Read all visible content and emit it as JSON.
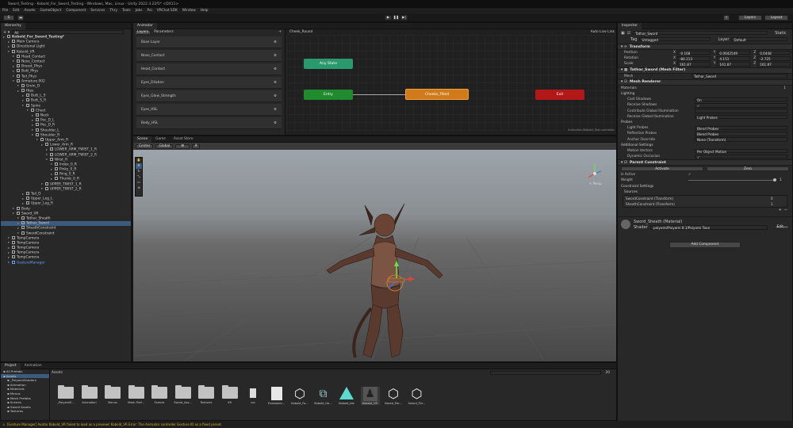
{
  "window": {
    "title": "Sword_Testing - Kobold_For_Sword_Testing - Windows, Mac, Linux - Unity 2022.3.22f1* <DX11>"
  },
  "menu": [
    "File",
    "Edit",
    "Assets",
    "GameObject",
    "Component",
    "Services",
    "Thry",
    "Tools",
    "Jobs",
    "Poi",
    "VRChat SDK",
    "Window",
    "Help"
  ],
  "toolbar": {
    "account": "S",
    "layers": "Layers",
    "layout": "Layout"
  },
  "hierarchy": {
    "tab": "Hierarchy",
    "search_placeholder": "All",
    "items": [
      {
        "label": "Kobold_For_Sword_Testing*",
        "indent": 0,
        "scene": true
      },
      {
        "label": "Main Camera",
        "indent": 1
      },
      {
        "label": "Directional Light",
        "indent": 1
      },
      {
        "label": "Kobold_VR",
        "indent": 1
      },
      {
        "label": "Head_Contact",
        "indent": 2
      },
      {
        "label": "Nose_Contact",
        "indent": 2
      },
      {
        "label": "Breast_Phys",
        "indent": 2
      },
      {
        "label": "Butt_Phys",
        "indent": 2
      },
      {
        "label": "Tail_Phys",
        "indent": 2
      },
      {
        "label": "Armature.002",
        "indent": 2
      },
      {
        "label": "Groin_D",
        "indent": 3
      },
      {
        "label": "Hips",
        "indent": 3
      },
      {
        "label": "Butt_L_S",
        "indent": 4
      },
      {
        "label": "Butt_S_R",
        "indent": 4
      },
      {
        "label": "Spine",
        "indent": 4
      },
      {
        "label": "Chest",
        "indent": 5
      },
      {
        "label": "Neck",
        "indent": 6
      },
      {
        "label": "Pec_D_L",
        "indent": 6
      },
      {
        "label": "Pec_D_R",
        "indent": 6
      },
      {
        "label": "Shoulder_L",
        "indent": 6
      },
      {
        "label": "Shoulder_R",
        "indent": 6
      },
      {
        "label": "Upper_Arm_R",
        "indent": 7
      },
      {
        "label": "Lower_Arm_R",
        "indent": 8
      },
      {
        "label": "LOWER_ARM_TWIST_1_R",
        "indent": 9
      },
      {
        "label": "LOWER_ARM_TWIST_2_R",
        "indent": 9
      },
      {
        "label": "Wrist_R",
        "indent": 9
      },
      {
        "label": "Index_0_R",
        "indent": 10
      },
      {
        "label": "Pinky_0_R",
        "indent": 10
      },
      {
        "label": "Ring_0_R",
        "indent": 10
      },
      {
        "label": "Thumb_0_R",
        "indent": 10
      },
      {
        "label": "UPPER_TWIST_1_R",
        "indent": 8
      },
      {
        "label": "UPPER_TWIST_2_R",
        "indent": 8
      },
      {
        "label": "Tail_D",
        "indent": 4
      },
      {
        "label": "Upper_Leg_L",
        "indent": 4
      },
      {
        "label": "Upper_Leg_R",
        "indent": 4
      },
      {
        "label": "Body",
        "indent": 2
      },
      {
        "label": "Sword_VR",
        "indent": 2
      },
      {
        "label": "Tathar_Sheath",
        "indent": 3
      },
      {
        "label": "Tathar_Sword",
        "indent": 3,
        "selected": true
      },
      {
        "label": "SheathConstraint",
        "indent": 3
      },
      {
        "label": "SwordConstraint",
        "indent": 3
      },
      {
        "label": "TempCamera",
        "indent": 1
      },
      {
        "label": "TempCamera",
        "indent": 1
      },
      {
        "label": "TempCamera",
        "indent": 1
      },
      {
        "label": "TempCamera",
        "indent": 1
      },
      {
        "label": "TempCamera",
        "indent": 1
      },
      {
        "label": "GestureManager",
        "indent": 1,
        "special": true
      }
    ]
  },
  "animator": {
    "tab": "Animator",
    "subtabs": [
      "Layers",
      "Parameters"
    ],
    "layer_path": "Cheek_Round",
    "auto_live_link": "Auto Live Link",
    "layers": [
      "Base Layer",
      "Nose_Contact",
      "Head_Contact",
      "Eyes_Dilation",
      "Eyes_Glow_Strength",
      "Eyes_HSL",
      "Body_HSL"
    ],
    "nodes": {
      "any_state": "Any State",
      "entry": "Entry",
      "state": "Cheeks_Filled",
      "exit": "Exit"
    },
    "status_path": "Animation/Kobold_Test.controller"
  },
  "scene": {
    "tabs": [
      "Scene",
      "Game",
      "Asset Store"
    ],
    "mode": "Center",
    "space": "Global",
    "persp_label": "< Persp"
  },
  "project": {
    "tabs": [
      "Project",
      "Animation"
    ],
    "breadcrumb": "Assets",
    "count": "20",
    "tree": [
      {
        "label": "All Prefabs",
        "indent": 0
      },
      {
        "label": "Assets",
        "indent": 0,
        "selected": true
      },
      {
        "label": "_PoiyomiShaders",
        "indent": 1
      },
      {
        "label": "Animation",
        "indent": 1
      },
      {
        "label": "Materials",
        "indent": 1
      },
      {
        "label": "Menus",
        "indent": 1
      },
      {
        "label": "Mesh Prefabs",
        "indent": 1
      },
      {
        "label": "Scenes",
        "indent": 1
      },
      {
        "label": "Sword Assets",
        "indent": 1
      },
      {
        "label": "Textures",
        "indent": 1
      }
    ],
    "assets": [
      {
        "label": "_PoiyomiS...",
        "type": "folder"
      },
      {
        "label": "Animation",
        "type": "folder"
      },
      {
        "label": "Menus",
        "type": "folder"
      },
      {
        "label": "Mesh Pref...",
        "type": "folder"
      },
      {
        "label": "Scenes",
        "type": "folder"
      },
      {
        "label": "Sword_Ass...",
        "type": "folder"
      },
      {
        "label": "Textures",
        "type": "folder"
      },
      {
        "label": "VR",
        "type": "folder"
      },
      {
        "label": "csc",
        "type": "file"
      },
      {
        "label": "Examples...",
        "type": "doc"
      },
      {
        "label": "Kobold_Fo...",
        "type": "unity"
      },
      {
        "label": "Kobold_Ge...",
        "type": "graph"
      },
      {
        "label": "Kobold_Ide",
        "type": "triangle"
      },
      {
        "label": "Kobold_VR",
        "type": "model"
      },
      {
        "label": "Sword_Par...",
        "type": "unity"
      },
      {
        "label": "Sword_Pin...",
        "type": "unity"
      }
    ]
  },
  "console": {
    "message": "[Gesture Manager] Avatar Kobold_VR failed to load as a preview! Kobold_VR Error: The Animator controller Gesture ID as a fixed preset."
  },
  "inspector": {
    "tab": "Inspector",
    "object_name": "Tathar_Sword",
    "static_label": "Static",
    "tag_label": "Tag",
    "tag_value": "Untagged",
    "layer_label": "Layer",
    "layer_value": "Default",
    "transform": {
      "title": "Transform",
      "position": {
        "label": "Position",
        "x": "-0.168",
        "y": "0.0642549",
        "z": "0.0448"
      },
      "rotation": {
        "label": "Rotation",
        "x": "-84.213",
        "y": "4.151",
        "z": "-2.725"
      },
      "scale": {
        "label": "Scale",
        "x": "161.87",
        "y": "161.87",
        "z": "161.87"
      }
    },
    "mesh_filter": {
      "title": "Tathar_Sword (Mesh Filter)",
      "mesh_label": "Mesh",
      "mesh_value": "Tathar_Sword"
    },
    "mesh_renderer": {
      "title": "Mesh Renderer",
      "materials_label": "Materials",
      "materials_count": "1",
      "lighting_label": "Lighting",
      "rows": [
        {
          "label": "Cast Shadows",
          "value": "On"
        },
        {
          "label": "Receive Shadows",
          "value": "✓"
        },
        {
          "label": "Contribute Global Illumination",
          "value": ""
        },
        {
          "label": "Receive Global Illumination",
          "value": "Light Probes"
        }
      ],
      "probes_label": "Probes",
      "probe_rows": [
        {
          "label": "Light Probes",
          "value": "Blend Probes"
        },
        {
          "label": "Reflection Probes",
          "value": "Blend Probes"
        },
        {
          "label": "Anchor Override",
          "value": "None (Transform)"
        }
      ],
      "additional_label": "Additional Settings",
      "additional_rows": [
        {
          "label": "Motion Vectors",
          "value": "Per Object Motion"
        },
        {
          "label": "Dynamic Occlusion",
          "value": "✓"
        }
      ]
    },
    "parent_constraint": {
      "title": "Parent Constraint",
      "activate": "Activate",
      "zero": "Zero",
      "is_active_label": "Is Active",
      "is_active_value": "✓",
      "weight_label": "Weight",
      "weight_value": "1",
      "settings_label": "Constraint Settings",
      "sources_label": "Sources",
      "sources": [
        {
          "label": "SwordConstraint (Transform)",
          "value": "0"
        },
        {
          "label": "SheathConstraint (Transform)",
          "value": "1"
        }
      ]
    },
    "material": {
      "title": "Sword_Sheath (Material)",
      "shader_label": "Shader",
      "shader_value": ".poiyomi/Poiyomi 8.1/Poiyomi Toon",
      "edit": "Edit..."
    },
    "add_component": "Add Component"
  }
}
